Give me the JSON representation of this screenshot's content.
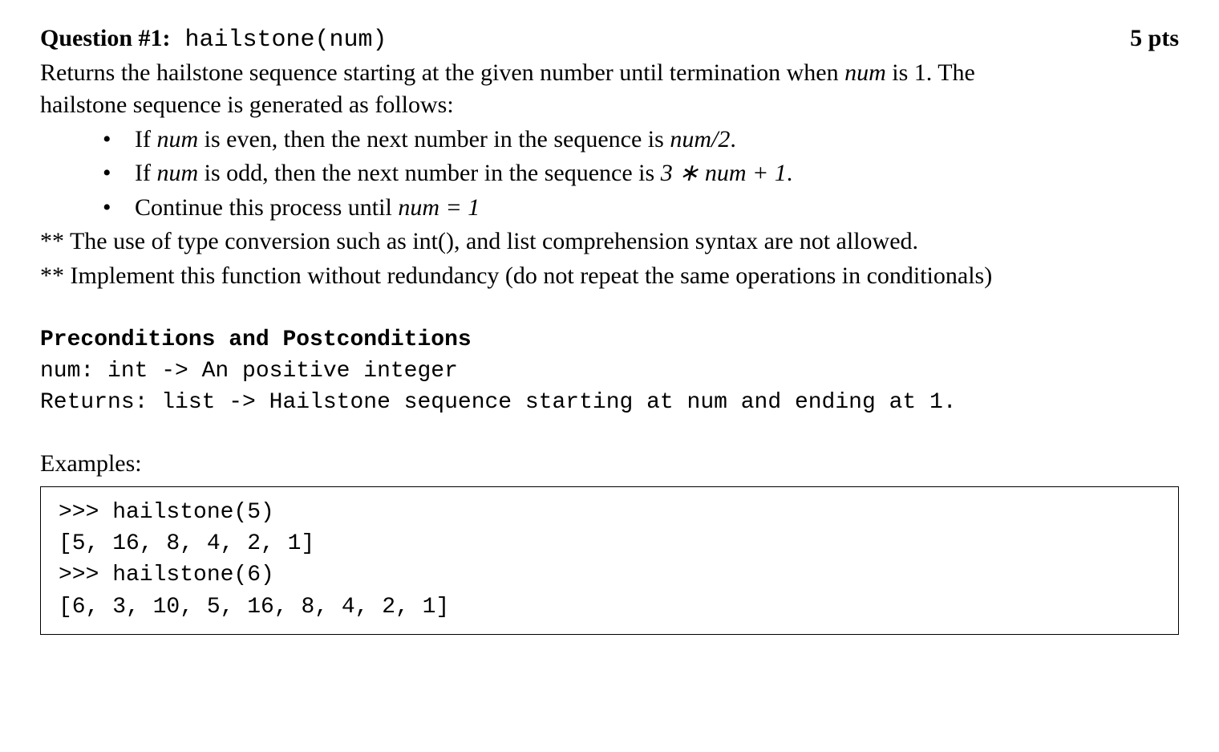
{
  "header": {
    "label_prefix": "Question #1:",
    "func_sig": " hailstone(num)",
    "points": "5 pts"
  },
  "intro": {
    "p1a": "Returns the hailstone sequence starting at the given number until termination when ",
    "p1_num": "num",
    "p1b": " is 1. The",
    "p2": "hailstone sequence is generated as follows:"
  },
  "bullets": {
    "b1a": "If ",
    "b1_num": "num",
    "b1b": " is even, then the next number in the sequence is ",
    "b1_expr": "num/2",
    "b1c": ".",
    "b2a": "If ",
    "b2_num": "num",
    "b2b": " is odd, then the next number in the sequence is ",
    "b2_expr": "3 ∗ num + 1",
    "b2c": ".",
    "b3a": "Continue this process until ",
    "b3_expr": "num = 1"
  },
  "notes": {
    "n1": "** The use of type conversion such as int(), and list comprehension syntax are not allowed.",
    "n2": "** Implement this function without redundancy (do not repeat the same operations in conditionals)"
  },
  "prepost": {
    "title": "Preconditions and Postconditions",
    "line1": "num: int -> An positive integer",
    "line2": "Returns: list -> Hailstone sequence starting at num and ending at 1."
  },
  "examples": {
    "label": "Examples:",
    "code": ">>> hailstone(5)\n[5, 16, 8, 4, 2, 1]\n>>> hailstone(6)\n[6, 3, 10, 5, 16, 8, 4, 2, 1]"
  }
}
